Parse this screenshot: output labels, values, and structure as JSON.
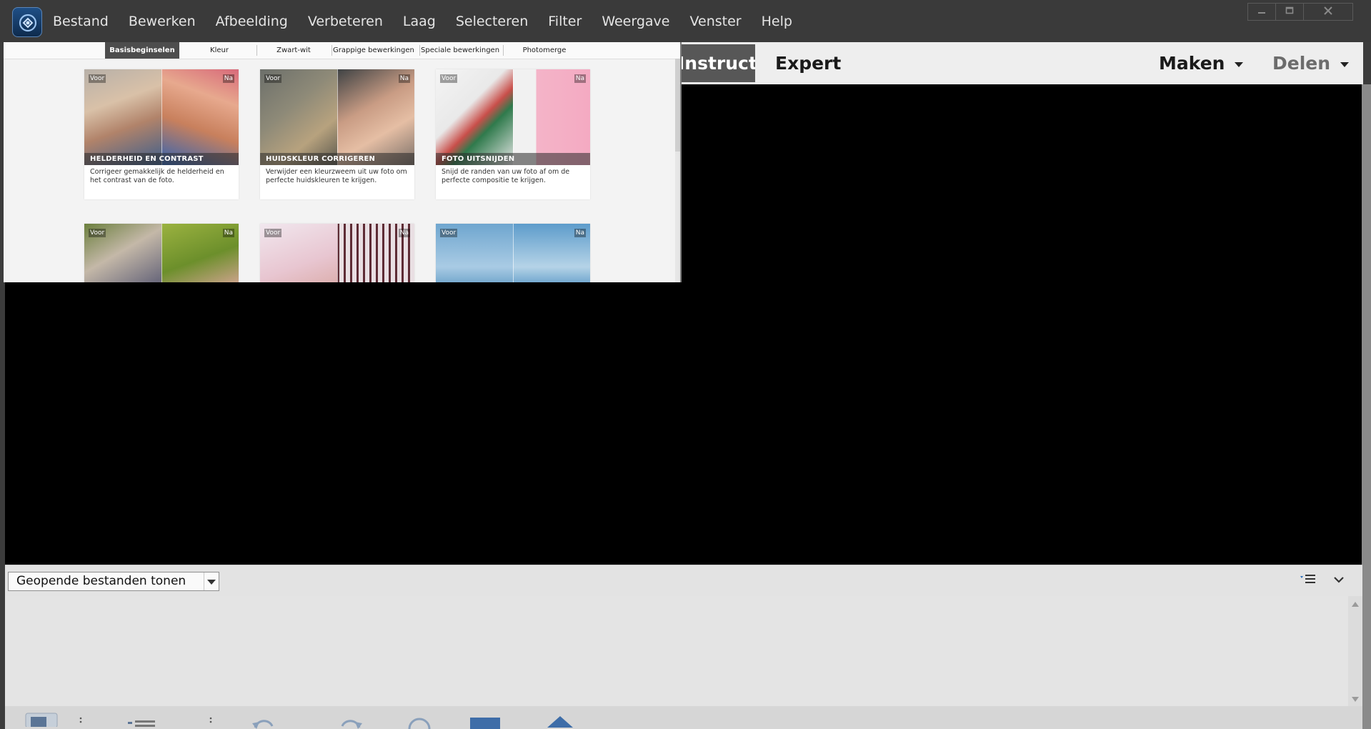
{
  "menubar": {
    "items": [
      "Bestand",
      "Bewerken",
      "Afbeelding",
      "Verbeteren",
      "Laag",
      "Selecteren",
      "Filter",
      "Weergave",
      "Venster",
      "Help"
    ],
    "window_controls": {
      "minimize": "minimize-icon",
      "restore": "restore-icon",
      "close": "close-icon"
    }
  },
  "modebar": {
    "instructies": "Instructies",
    "expert": "Expert",
    "maken": "Maken",
    "delen": "Delen"
  },
  "guided": {
    "tabs": [
      "Basisbeginselen",
      "Kleur",
      "Zwart-wit",
      "Grappige bewerkingen",
      "Speciale bewerkingen",
      "Photomerge"
    ],
    "active_tab": "Basisbeginselen",
    "before_label": "Voor",
    "after_label": "Na",
    "cards": [
      {
        "title": "HELDERHEID EN CONTRAST",
        "desc": "Corrigeer gemakkelijk de helderheid en het contrast van de foto."
      },
      {
        "title": "HUIDSKLEUR CORRIGEREN",
        "desc": "Verwijder een kleurzweem uit uw foto om perfecte huidskleuren te krijgen."
      },
      {
        "title": "FOTO UITSNIJDEN",
        "desc": "Snijd de randen van uw foto af om de perfecte compositie te krijgen."
      },
      {
        "title": "",
        "desc": ""
      },
      {
        "title": "",
        "desc": ""
      },
      {
        "title": "",
        "desc": ""
      }
    ]
  },
  "bin": {
    "select_value": "Geopende bestanden tonen"
  },
  "colors": {
    "menubar_bg": "#3a3a3a",
    "canvas_bg": "#000000",
    "mode_active_bg": "#575757"
  }
}
